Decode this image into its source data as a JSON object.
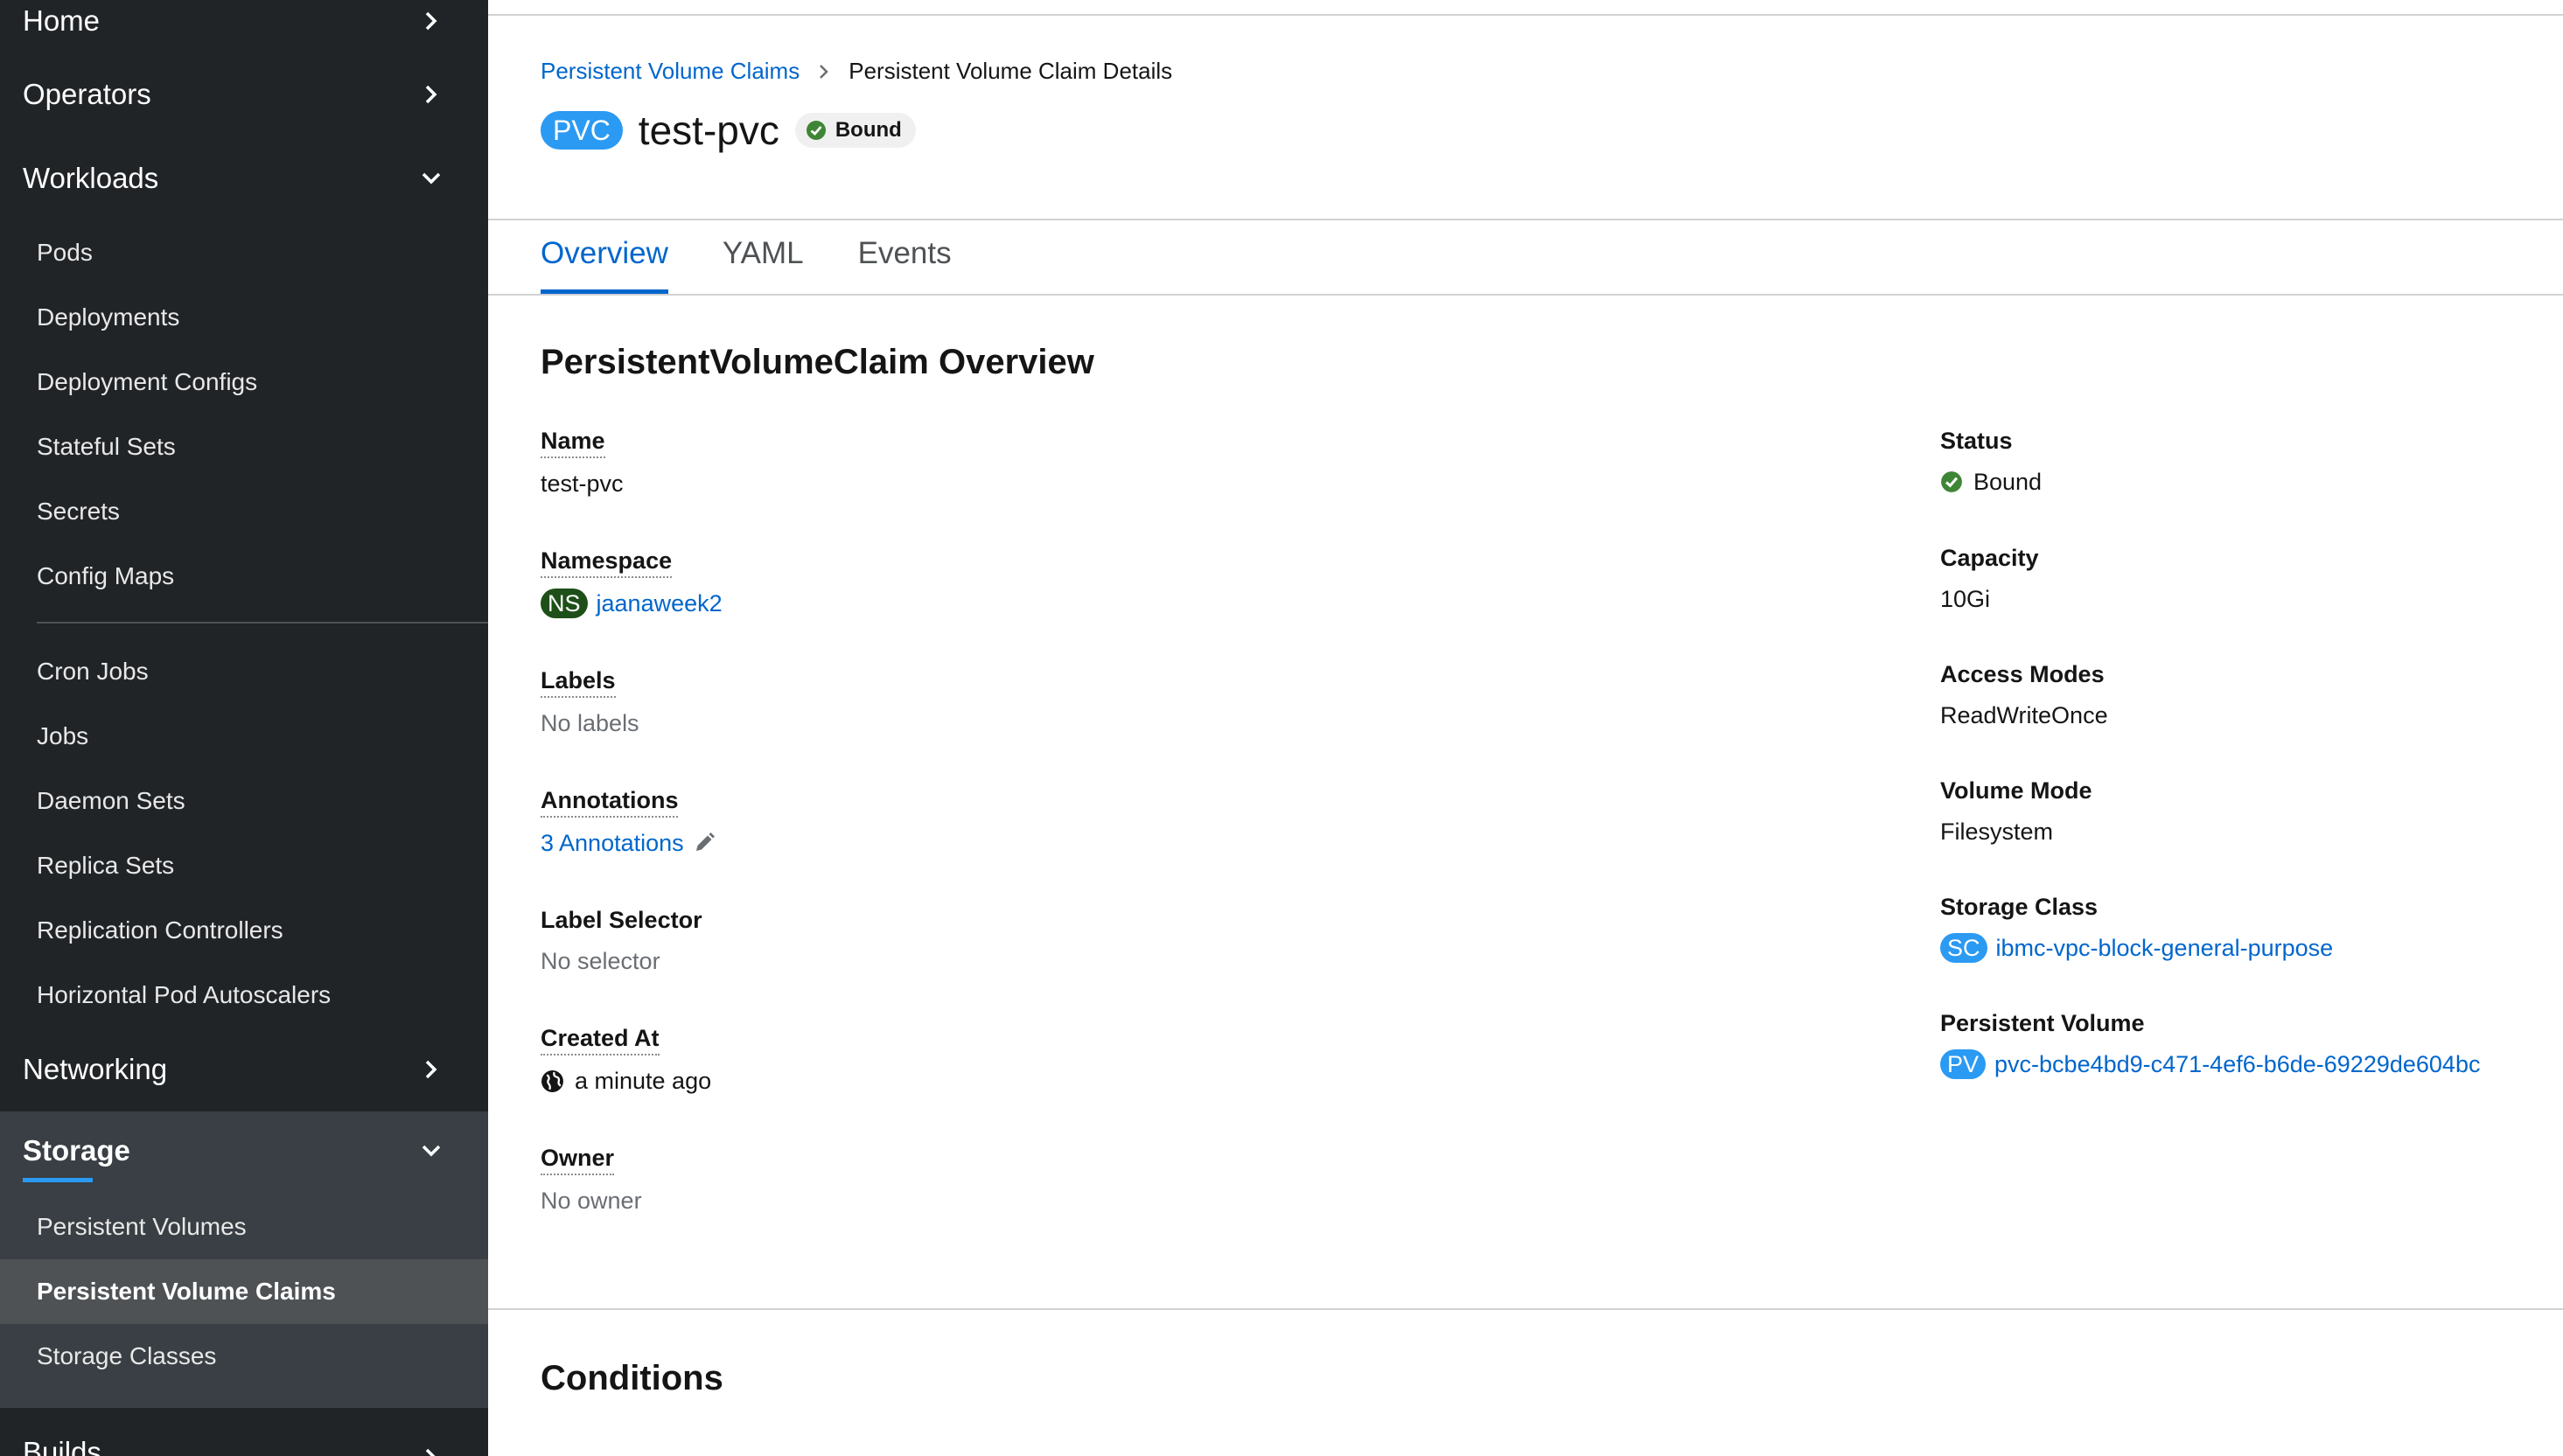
{
  "sidebar": {
    "home": "Home",
    "operators": "Operators",
    "workloads": "Workloads",
    "workload_items": [
      "Pods",
      "Deployments",
      "Deployment Configs",
      "Stateful Sets",
      "Secrets",
      "Config Maps"
    ],
    "workload_items_2": [
      "Cron Jobs",
      "Jobs",
      "Daemon Sets",
      "Replica Sets",
      "Replication Controllers",
      "Horizontal Pod Autoscalers"
    ],
    "networking": "Networking",
    "storage": "Storage",
    "storage_items": [
      "Persistent Volumes",
      "Persistent Volume Claims",
      "Storage Classes"
    ],
    "builds": "Builds"
  },
  "breadcrumb": {
    "parent": "Persistent Volume Claims",
    "current": "Persistent Volume Claim Details"
  },
  "header": {
    "kind_badge": "PVC",
    "name": "test-pvc",
    "status": "Bound"
  },
  "tabs": [
    "Overview",
    "YAML",
    "Events"
  ],
  "overview": {
    "title": "PersistentVolumeClaim Overview",
    "left": {
      "name_label": "Name",
      "name_value": "test-pvc",
      "namespace_label": "Namespace",
      "namespace_badge": "NS",
      "namespace_value": "jaanaweek2",
      "labels_label": "Labels",
      "labels_value": "No labels",
      "annotations_label": "Annotations",
      "annotations_value": "3 Annotations",
      "selector_label": "Label Selector",
      "selector_value": "No selector",
      "created_label": "Created At",
      "created_value": "a minute ago",
      "owner_label": "Owner",
      "owner_value": "No owner"
    },
    "right": {
      "status_label": "Status",
      "status_value": "Bound",
      "capacity_label": "Capacity",
      "capacity_value": "10Gi",
      "access_label": "Access Modes",
      "access_value": "ReadWriteOnce",
      "volume_mode_label": "Volume Mode",
      "volume_mode_value": "Filesystem",
      "storage_class_label": "Storage Class",
      "storage_class_badge": "SC",
      "storage_class_value": "ibmc-vpc-block-general-purpose",
      "pv_label": "Persistent Volume",
      "pv_badge": "PV",
      "pv_value": "pvc-bcbe4bd9-c471-4ef6-b6de-69229de604bc"
    }
  },
  "conditions_title": "Conditions",
  "colors": {
    "sidebar_bg": "#212427",
    "link": "#0066cc",
    "badge_blue": "#2b9af3",
    "ns_badge": "#1e4f18",
    "status_green": "#3e8635"
  },
  "icons": [
    "chevron-right-icon",
    "chevron-down-icon",
    "check-circle-icon",
    "globe-icon",
    "pencil-icon"
  ]
}
